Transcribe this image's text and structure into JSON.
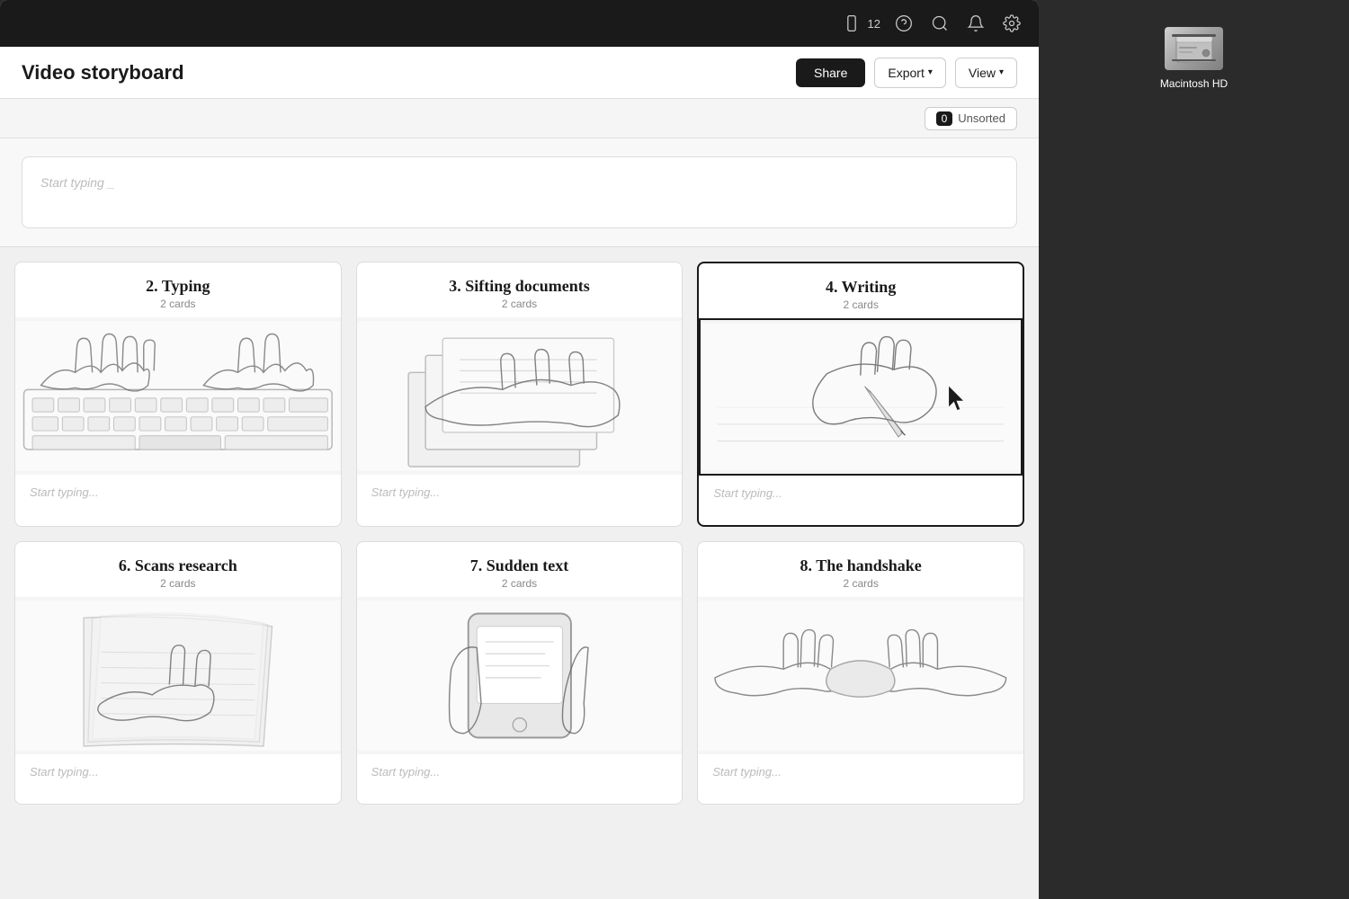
{
  "app": {
    "title": "Video storyboard",
    "badge_count": "12"
  },
  "toolbar": {
    "share_label": "Share",
    "export_label": "Export",
    "view_label": "View",
    "unsorted_label": "Unsorted",
    "unsorted_count": "0"
  },
  "cards": [
    {
      "id": 2,
      "title": "2. Typing",
      "subtitle": "2 cards",
      "placeholder": "Start typing...",
      "selected": false
    },
    {
      "id": 3,
      "title": "3. Sifting documents",
      "subtitle": "2 cards",
      "placeholder": "Start typing...",
      "selected": false
    },
    {
      "id": 4,
      "title": "4. Writing",
      "subtitle": "2 cards",
      "placeholder": "Start typing...",
      "selected": true
    },
    {
      "id": 6,
      "title": "6. Scans research",
      "subtitle": "2 cards",
      "placeholder": "Start typing...",
      "selected": false
    },
    {
      "id": 7,
      "title": "7. Sudden text",
      "subtitle": "2 cards",
      "placeholder": "Start typing...",
      "selected": false
    },
    {
      "id": 8,
      "title": "8. The handshake",
      "subtitle": "2 cards",
      "placeholder": "Start typing...",
      "selected": false
    }
  ],
  "mac_hd": {
    "label": "Macintosh HD"
  },
  "typing_card": {
    "placeholder": "Start typing _"
  }
}
